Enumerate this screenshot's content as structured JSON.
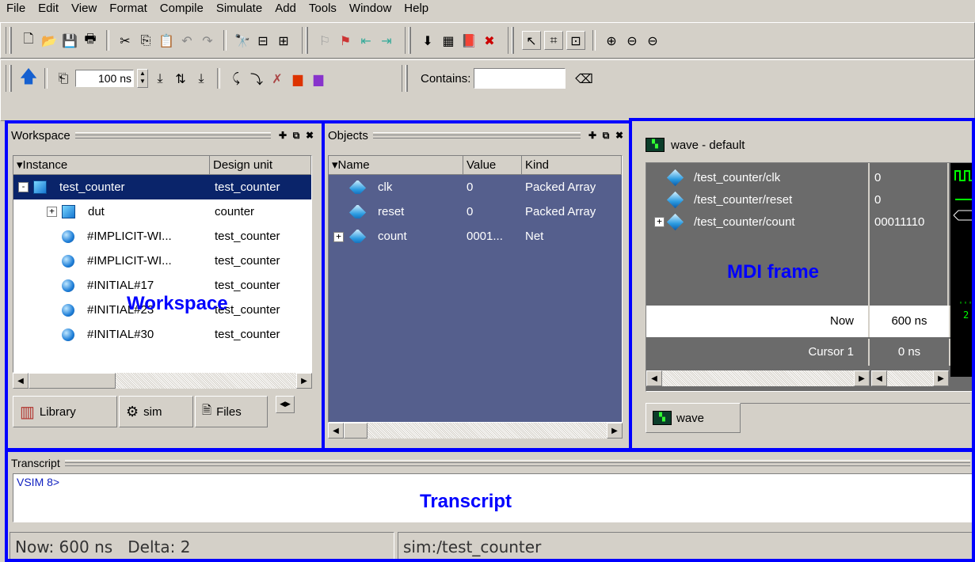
{
  "menu": [
    "File",
    "Edit",
    "View",
    "Format",
    "Compile",
    "Simulate",
    "Add",
    "Tools",
    "Window",
    "Help"
  ],
  "toolbar1": {
    "icons": [
      "new-file-icon",
      "open-folder-icon",
      "save-icon",
      "print-icon",
      "cut-icon",
      "copy-icon",
      "paste-icon",
      "undo-icon",
      "redo-icon",
      "find-icon",
      "collapse-icon",
      "expand-icon",
      "insert-breakpoint-icon",
      "clear-breakpoint-icon",
      "step-in-icon",
      "step-out-icon",
      "compile-icon",
      "compile-all-icon",
      "simulate-icon",
      "break-icon",
      "select-mode-icon",
      "zoom-mode-icon",
      "zoom-full-icon",
      "zoom-in-icon",
      "zoom-out-icon"
    ]
  },
  "toolbar2": {
    "run_length": "100 ns",
    "contains_label": "Contains:",
    "contains_value": ""
  },
  "workspace": {
    "title": "Workspace",
    "columns": [
      "Instance",
      "Design unit"
    ],
    "rows": [
      {
        "instance": "test_counter",
        "unit": "test_counter",
        "icon": "cube",
        "expander": "-",
        "selected": true,
        "indent": 0
      },
      {
        "instance": "dut",
        "unit": "counter",
        "icon": "cube",
        "expander": "+",
        "selected": false,
        "indent": 1
      },
      {
        "instance": "#IMPLICIT-WI...",
        "unit": "test_counter",
        "icon": "ball",
        "expander": "",
        "selected": false,
        "indent": 1
      },
      {
        "instance": "#IMPLICIT-WI...",
        "unit": "test_counter",
        "icon": "ball",
        "expander": "",
        "selected": false,
        "indent": 1
      },
      {
        "instance": "#INITIAL#17",
        "unit": "test_counter",
        "icon": "ball",
        "expander": "",
        "selected": false,
        "indent": 1
      },
      {
        "instance": "#INITIAL#23",
        "unit": "test_counter",
        "icon": "ball",
        "expander": "",
        "selected": false,
        "indent": 1
      },
      {
        "instance": "#INITIAL#30",
        "unit": "test_counter",
        "icon": "ball",
        "expander": "",
        "selected": false,
        "indent": 1
      }
    ],
    "tabs": [
      "Library",
      "sim",
      "Files"
    ]
  },
  "objects": {
    "title": "Objects",
    "columns": [
      "Name",
      "Value",
      "Kind"
    ],
    "rows": [
      {
        "name": "clk",
        "value": "0",
        "kind": "Packed Array",
        "expander": ""
      },
      {
        "name": "reset",
        "value": "0",
        "kind": "Packed Array",
        "expander": ""
      },
      {
        "name": "count",
        "value": "0001...",
        "kind": "Net",
        "expander": "+"
      }
    ]
  },
  "wave": {
    "title": "wave - default",
    "signals": [
      {
        "name": "/test_counter/clk",
        "value": "0",
        "expander": ""
      },
      {
        "name": "/test_counter/reset",
        "value": "0",
        "expander": ""
      },
      {
        "name": "/test_counter/count",
        "value": "00011110",
        "expander": "+"
      }
    ],
    "now_label": "Now",
    "now_value": "600 ns",
    "cursor_label": "Cursor 1",
    "cursor_value": "0 ns",
    "tab": "wave"
  },
  "transcript": {
    "title": "Transcript",
    "prompt": "VSIM 8>"
  },
  "status": {
    "now": "Now: 600 ns",
    "delta": "Delta: 2",
    "context": "sim:/test_counter"
  },
  "annotations": {
    "workspace": "Workspace",
    "mdi": "MDI frame",
    "transcript": "Transcript"
  },
  "colors": {
    "objects_bg": "#555f8d",
    "wave_bg": "#6b6b6b",
    "selection": "#0a246a",
    "annotation": "#0000ff"
  }
}
